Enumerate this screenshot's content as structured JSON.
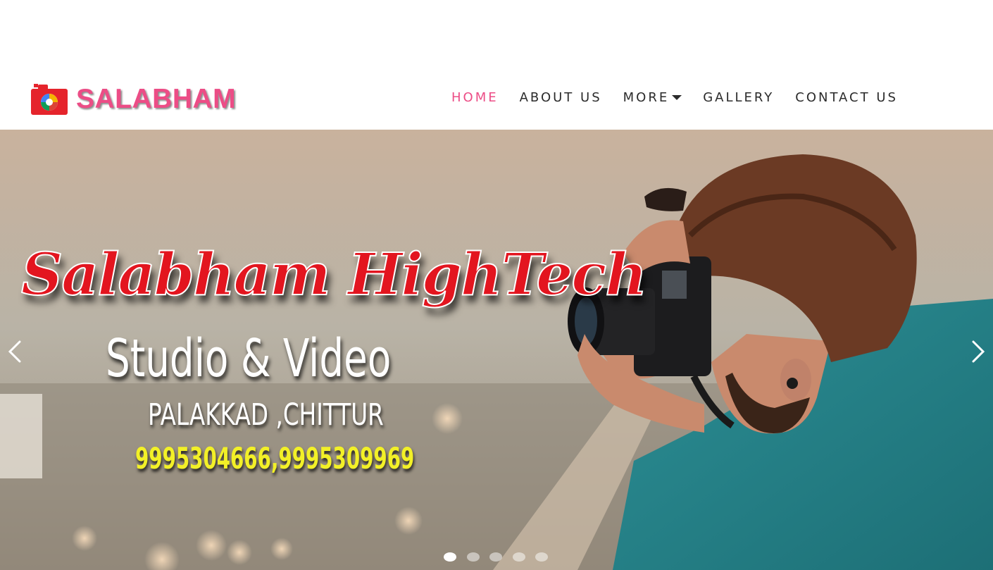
{
  "brand": {
    "name": "SALABHAM",
    "logo_icon": "camera-logo-icon"
  },
  "nav": {
    "items": [
      {
        "label": "HOME",
        "active": true
      },
      {
        "label": "ABOUT US",
        "active": false
      },
      {
        "label": "MORE",
        "active": false,
        "has_dropdown": true
      },
      {
        "label": "GALLERY",
        "active": false
      },
      {
        "label": "CONTACT US",
        "active": false
      }
    ]
  },
  "hero": {
    "headline": "Salabham HighTech",
    "line1": "Studio & Video",
    "line2": "PALAKKAD ,CHITTUR",
    "line3": "9995304666,9995309969"
  },
  "carousel": {
    "prev_icon": "chevron-left-icon",
    "next_icon": "chevron-right-icon",
    "slide_count": 5,
    "active_index": 0
  },
  "colors": {
    "accent": "#ec4d86",
    "nav_text": "#2b2b2b",
    "headline_red": "#e3151f",
    "phone_yellow": "#f2f027"
  }
}
